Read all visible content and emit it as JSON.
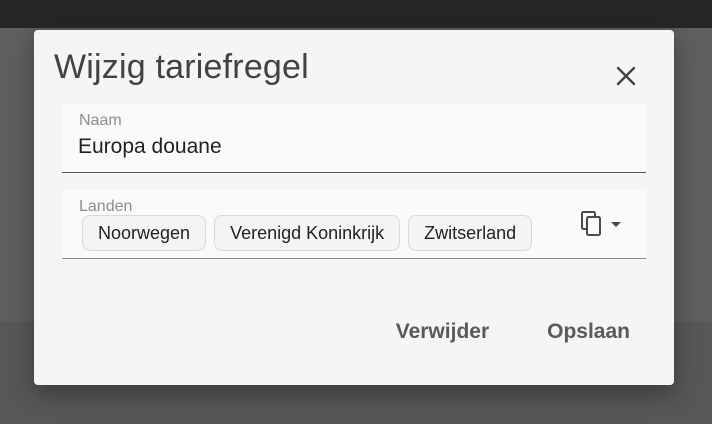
{
  "dialog": {
    "title": "Wijzig tariefregel",
    "close_icon": "close-icon"
  },
  "name_field": {
    "label": "Naam",
    "value": "Europa douane"
  },
  "countries_field": {
    "label": "Landen",
    "chips": [
      "Noorwegen",
      "Verenigd Koninkrijk",
      "Zwitserland"
    ],
    "menu_icon": "copy-icon"
  },
  "actions": {
    "delete_label": "Verwijder",
    "save_label": "Opslaan"
  },
  "colors": {
    "backdrop": "#5f5f5f",
    "topbar": "#262626",
    "dialog_bg": "#f5f5f5",
    "title_text": "#424242",
    "action_text": "#5a5a5a"
  }
}
